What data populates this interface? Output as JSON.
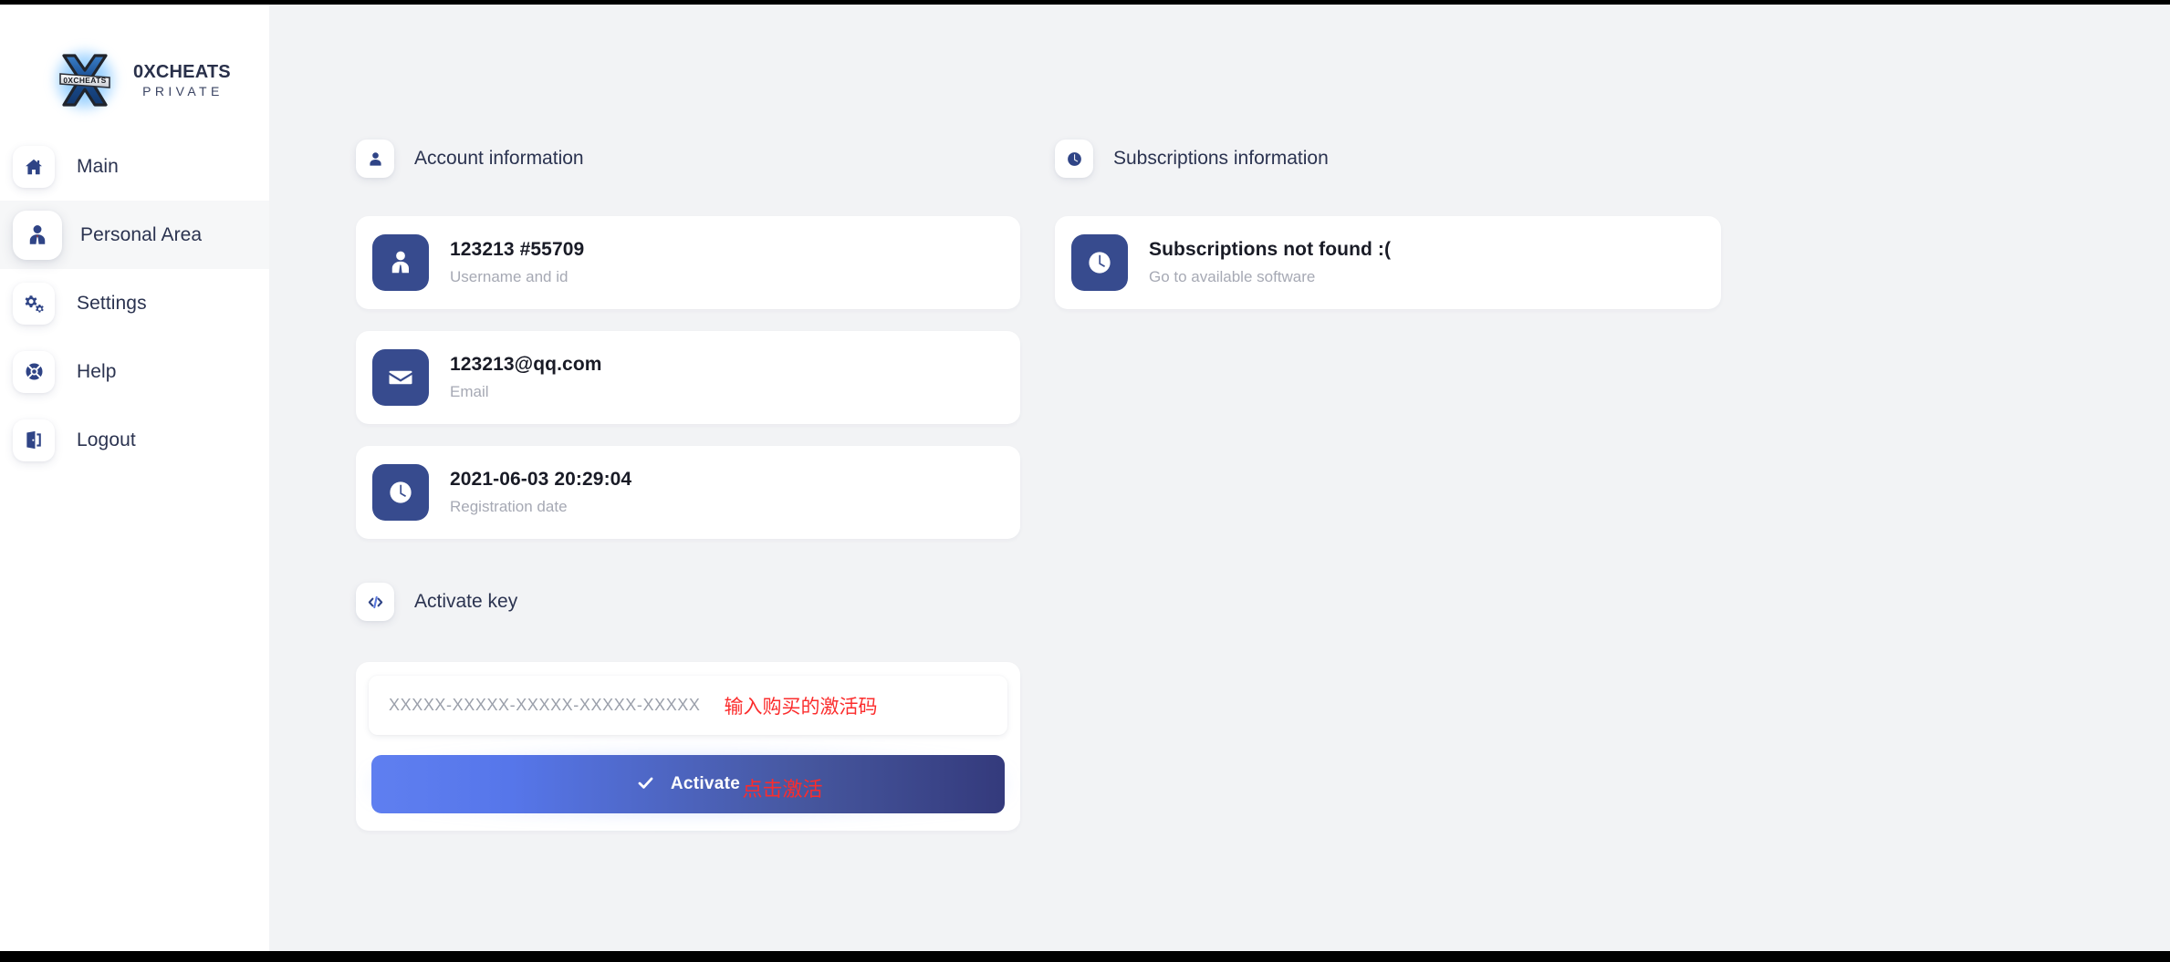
{
  "brand": {
    "title": "0XCHEATS",
    "subtitle": "PRIVATE",
    "logo_icon": "x-shield-logo-icon",
    "logo_banner_text": "0XCHEATS"
  },
  "sidebar": {
    "items": [
      {
        "label": "Main",
        "icon": "home-icon",
        "active": false
      },
      {
        "label": "Personal Area",
        "icon": "user-tie-icon",
        "active": true
      },
      {
        "label": "Settings",
        "icon": "gears-icon",
        "active": false
      },
      {
        "label": "Help",
        "icon": "life-ring-icon",
        "active": false
      },
      {
        "label": "Logout",
        "icon": "sign-out-icon",
        "active": false
      }
    ]
  },
  "account_section": {
    "heading": "Account information",
    "heading_icon": "user-icon",
    "cards": [
      {
        "title": "123213 #55709",
        "subtitle": "Username and id",
        "icon": "user-tie-icon"
      },
      {
        "title": "123213@qq.com",
        "subtitle": "Email",
        "icon": "envelope-icon"
      },
      {
        "title": "2021-06-03 20:29:04",
        "subtitle": "Registration date",
        "icon": "clock-icon"
      }
    ]
  },
  "subscriptions_section": {
    "heading": "Subscriptions information",
    "heading_icon": "clock-icon",
    "cards": [
      {
        "title": "Subscriptions not found :(",
        "subtitle": "Go to available software",
        "icon": "clock-icon"
      }
    ]
  },
  "activate_section": {
    "heading": "Activate key",
    "heading_icon": "code-icon",
    "input_placeholder": "XXXXX-XXXXX-XXXXX-XXXXX-XXXXX",
    "input_value": "",
    "input_annotation": "输入购买的激活码",
    "button_label": "Activate",
    "button_icon": "check-icon",
    "button_annotation": "点击激活"
  },
  "colors": {
    "accent_navy": "#374b8e",
    "text_dark": "#2b3350",
    "muted": "#a6a9b4",
    "annotation_red": "#fb2c2c",
    "page_bg": "#f2f3f5",
    "button_gradient_start": "#5f7ff0",
    "button_gradient_end": "#343a7c"
  }
}
